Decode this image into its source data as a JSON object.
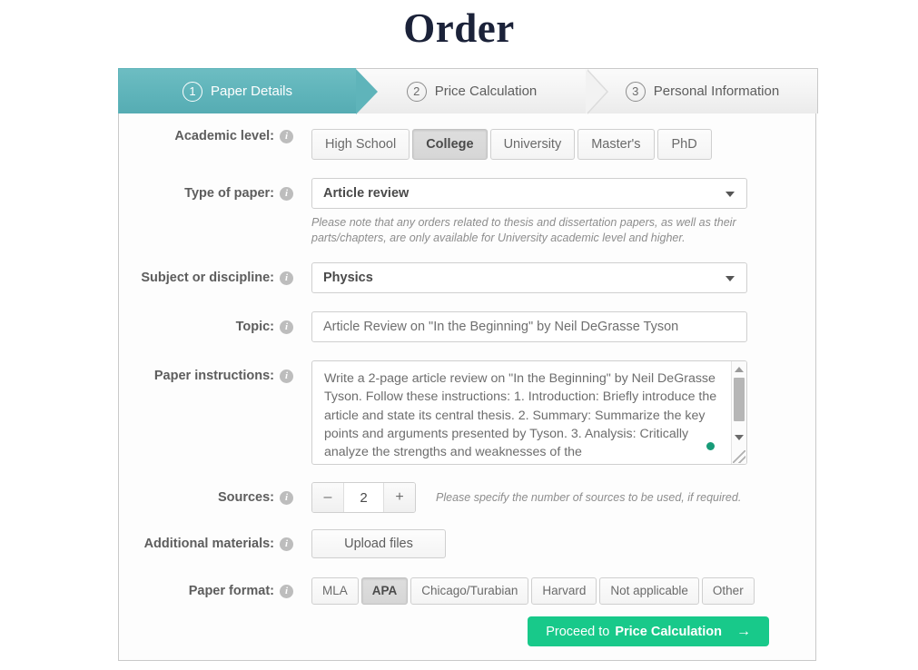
{
  "page": {
    "title": "Order"
  },
  "steps": [
    {
      "number": "1",
      "label": "Paper Details",
      "active": true
    },
    {
      "number": "2",
      "label": "Price Calculation",
      "active": false
    },
    {
      "number": "3",
      "label": "Personal Information",
      "active": false
    }
  ],
  "colors": {
    "active_step": "#5fb4ba",
    "proceed_button": "#18c98a",
    "title": "#1b2239",
    "caret_dot": "#179b78"
  },
  "form": {
    "academic_level": {
      "label": "Academic level:",
      "options": [
        "High School",
        "College",
        "University",
        "Master's",
        "PhD"
      ],
      "selected": "College"
    },
    "type_of_paper": {
      "label": "Type of paper:",
      "value": "Article review",
      "note": "Please note that any orders related to thesis and dissertation papers, as well as their parts/chapters, are only available for University academic level and higher."
    },
    "subject": {
      "label": "Subject or discipline:",
      "value": "Physics"
    },
    "topic": {
      "label": "Topic:",
      "value": "Article Review on \"In the Beginning\" by Neil DeGrasse Tyson"
    },
    "instructions": {
      "label": "Paper instructions:",
      "value": "Write a 2-page article review on \"In the Beginning\" by Neil DeGrasse Tyson. Follow these instructions: 1. Introduction: Briefly introduce the article and state its central thesis. 2. Summary: Summarize the key points and arguments presented by Tyson. 3. Analysis: Critically analyze the strengths and weaknesses of the"
    },
    "sources": {
      "label": "Sources:",
      "decrement": "–",
      "value": "2",
      "increment": "+",
      "hint": "Please specify the number of sources to be used, if required."
    },
    "additional_materials": {
      "label": "Additional materials:",
      "upload_label": "Upload files"
    },
    "paper_format": {
      "label": "Paper format:",
      "options": [
        "MLA",
        "APA",
        "Chicago/Turabian",
        "Harvard",
        "Not applicable",
        "Other"
      ],
      "selected": "APA"
    }
  },
  "footer": {
    "proceed_prefix": "Proceed to ",
    "proceed_strong": "Price Calculation",
    "proceed_arrow": "→"
  }
}
